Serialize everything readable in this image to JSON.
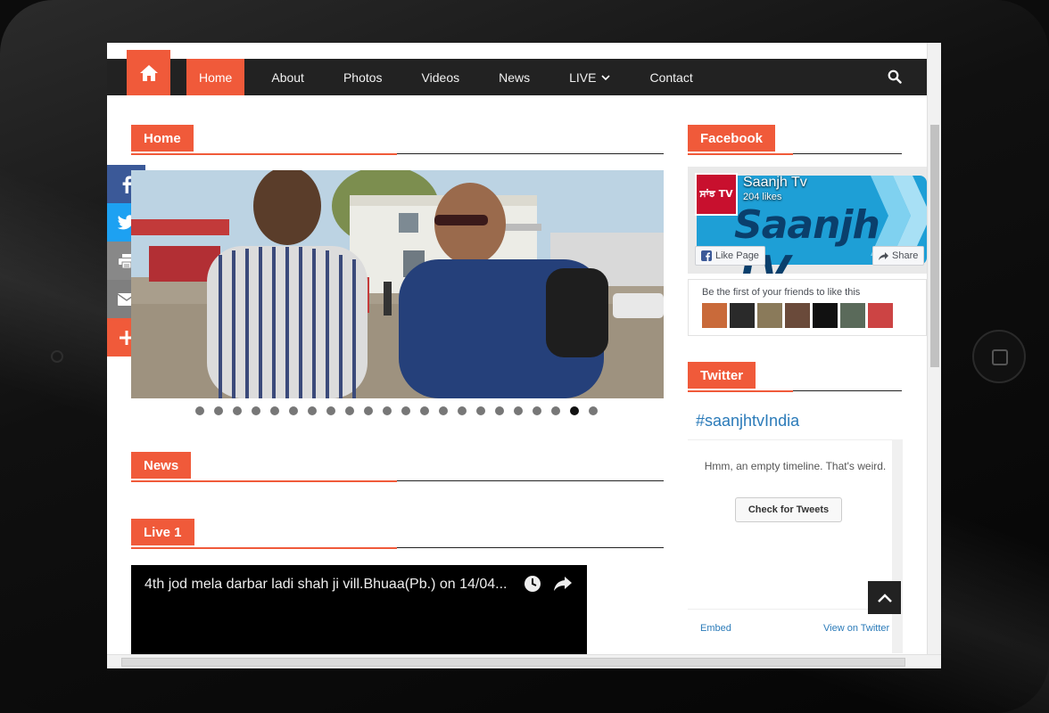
{
  "nav": {
    "items": [
      {
        "label": "Home",
        "active": true
      },
      {
        "label": "About"
      },
      {
        "label": "Photos"
      },
      {
        "label": "Videos"
      },
      {
        "label": "News"
      },
      {
        "label": "LIVE"
      },
      {
        "label": "Contact"
      }
    ]
  },
  "sections": {
    "home": "Home",
    "news": "News",
    "live": "Live 1",
    "facebook": "Facebook",
    "twitter": "Twitter"
  },
  "slider": {
    "dot_count": 22,
    "active_dot": 20
  },
  "video": {
    "title": "4th jod mela darbar ladi shah ji vill.Bhuaa(Pb.) on 14/04..."
  },
  "facebook": {
    "page_name": "Saanjh Tv",
    "likes": "204 likes",
    "cover_text": "Saanjh TV",
    "logo_text": "ਸਾਂਝ TV",
    "like_button": "Like Page",
    "share_button": "Share",
    "friends_text": "Be the first of your friends to like this"
  },
  "twitter": {
    "hashtag": "#saanjhtvIndia",
    "empty_message": "Hmm, an empty timeline. That's weird.",
    "check_button": "Check for Tweets",
    "embed_link": "Embed",
    "view_link": "View on Twitter"
  },
  "colors": {
    "accent": "#f05a3a",
    "nav_bg": "#222222",
    "facebook": "#3b5998",
    "twitter": "#1da1f2",
    "print": "#888888",
    "email": "#7f7f7f",
    "more": "#f05a3a"
  }
}
